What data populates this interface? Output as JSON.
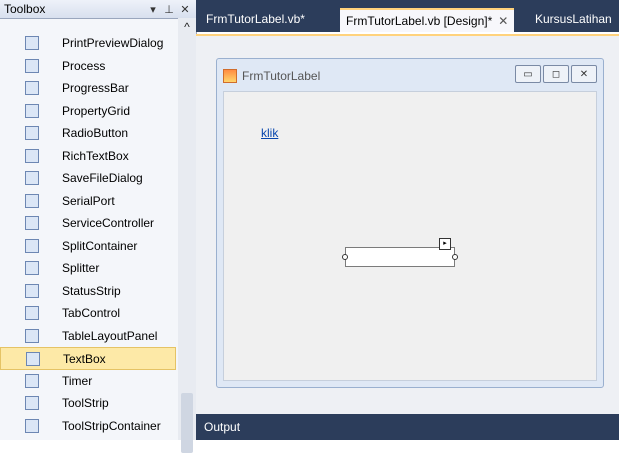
{
  "toolbox": {
    "title": "Toolbox",
    "pin_icon": "pin-icon",
    "close_icon": "close-icon",
    "items": [
      {
        "label": "PrintPreviewDialog",
        "icon": "print-preview-icon"
      },
      {
        "label": "Process",
        "icon": "process-icon"
      },
      {
        "label": "ProgressBar",
        "icon": "progressbar-icon"
      },
      {
        "label": "PropertyGrid",
        "icon": "propertygrid-icon"
      },
      {
        "label": "RadioButton",
        "icon": "radiobutton-icon"
      },
      {
        "label": "RichTextBox",
        "icon": "richtextbox-icon"
      },
      {
        "label": "SaveFileDialog",
        "icon": "savefiledialog-icon"
      },
      {
        "label": "SerialPort",
        "icon": "serialport-icon"
      },
      {
        "label": "ServiceController",
        "icon": "servicecontroller-icon"
      },
      {
        "label": "SplitContainer",
        "icon": "splitcontainer-icon"
      },
      {
        "label": "Splitter",
        "icon": "splitter-icon"
      },
      {
        "label": "StatusStrip",
        "icon": "statusstrip-icon"
      },
      {
        "label": "TabControl",
        "icon": "tabcontrol-icon"
      },
      {
        "label": "TableLayoutPanel",
        "icon": "tablelayoutpanel-icon"
      },
      {
        "label": "TextBox",
        "icon": "textbox-icon",
        "selected": true
      },
      {
        "label": "Timer",
        "icon": "timer-icon"
      },
      {
        "label": "ToolStrip",
        "icon": "toolstrip-icon"
      },
      {
        "label": "ToolStripContainer",
        "icon": "toolstripcontainer-icon"
      }
    ]
  },
  "tabs": [
    {
      "label": "FrmTutorLabel.vb*"
    },
    {
      "label": "FrmTutorLabel.vb [Design]*",
      "active": true
    },
    {
      "label": "KursusLatihan"
    }
  ],
  "form": {
    "title": "FrmTutorLabel",
    "link_label": "klik"
  },
  "output": {
    "label": "Output"
  },
  "colors": {
    "accent": "#ffd27c",
    "dark_chrome": "#2c3d5b",
    "selected": "#fde9a7"
  }
}
